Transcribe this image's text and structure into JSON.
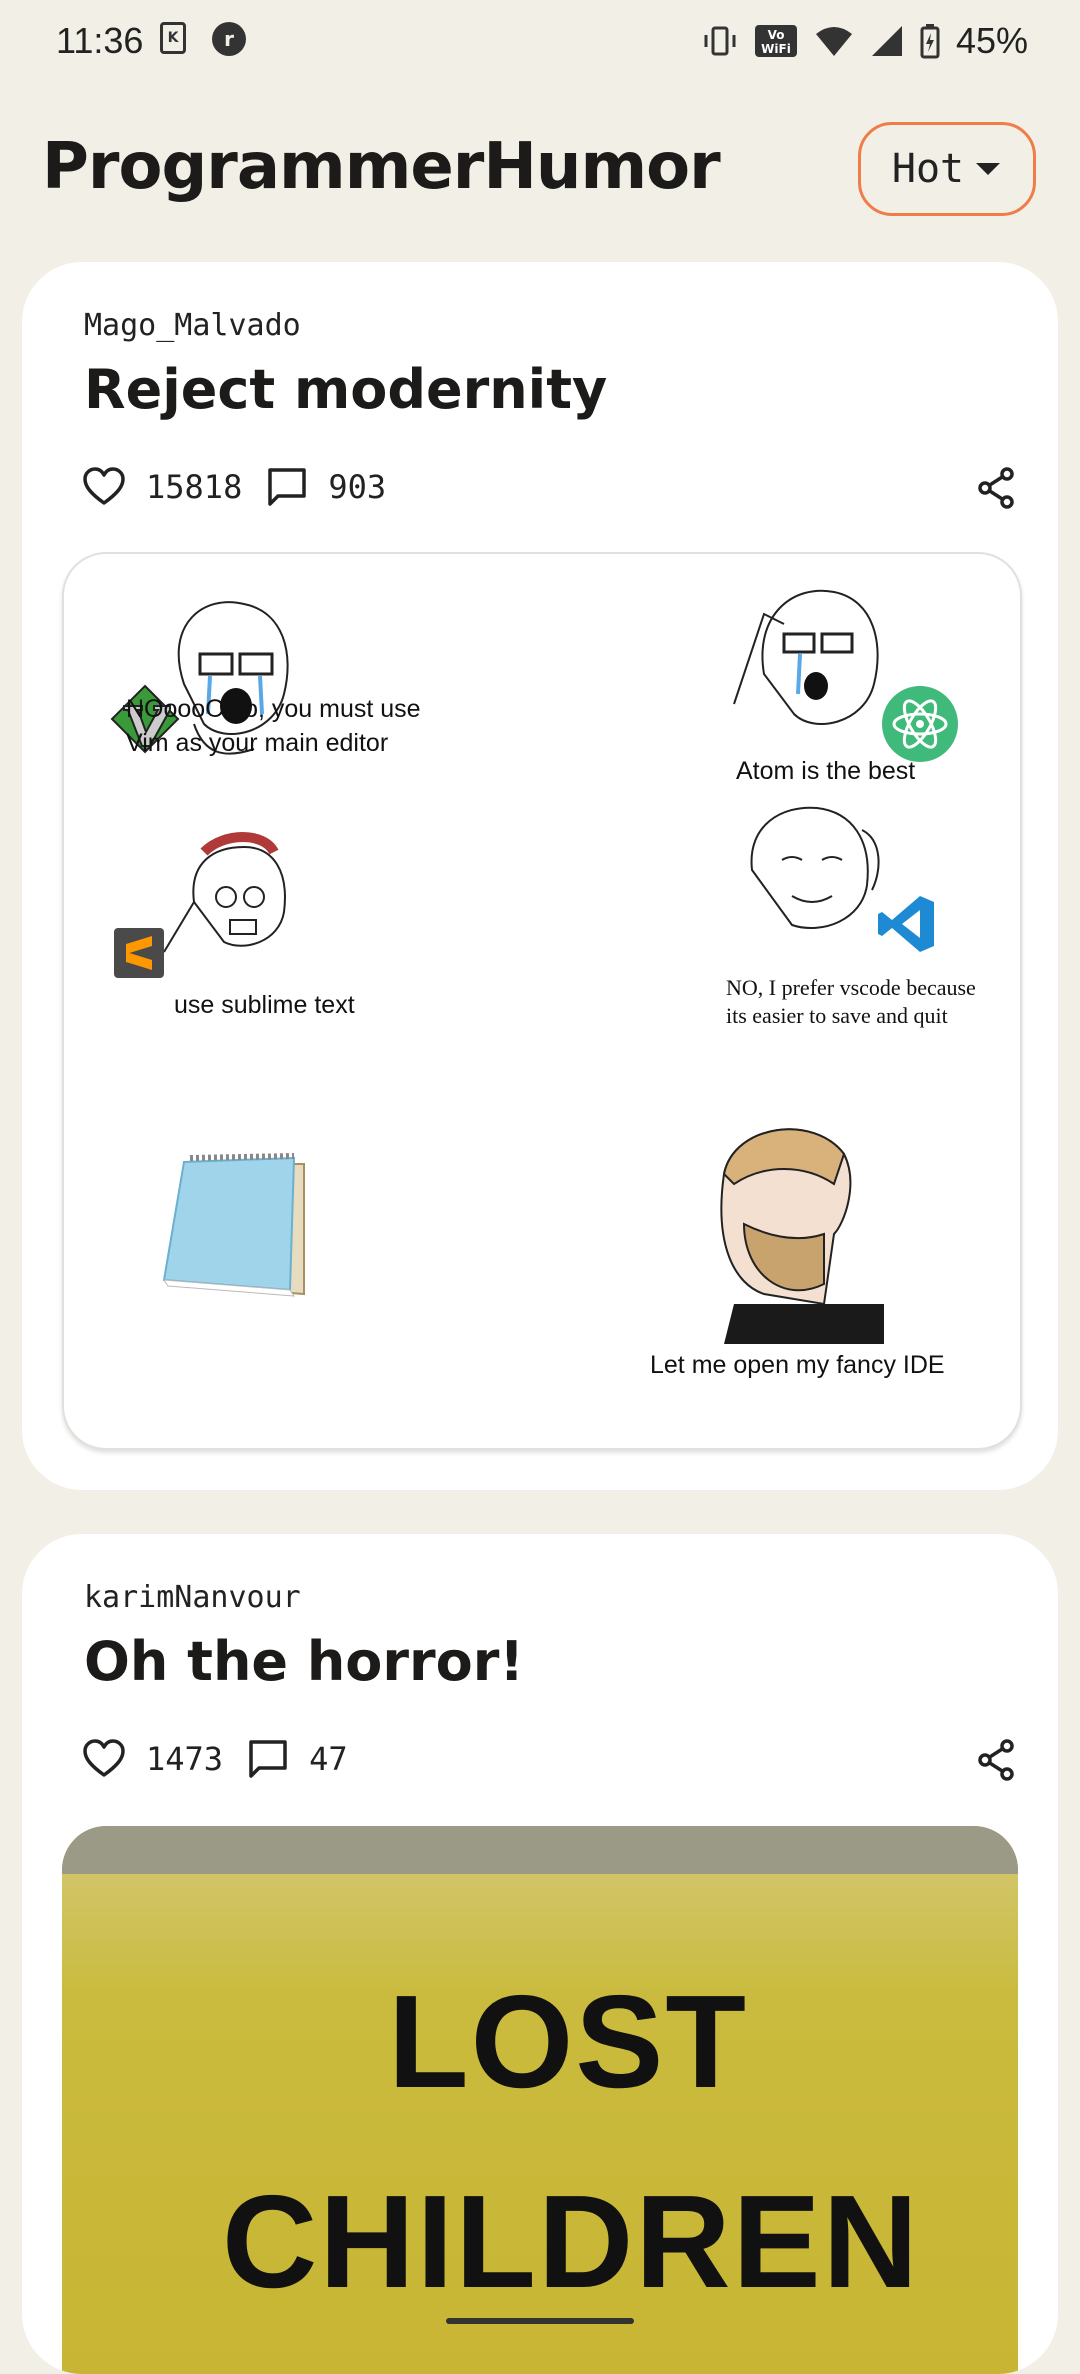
{
  "status_bar": {
    "time": "11:36",
    "battery": "45%"
  },
  "header": {
    "subreddit": "ProgrammerHumor",
    "sort_label": "Hot"
  },
  "posts": [
    {
      "author": "Mago_Malvado",
      "title": "Reject modernity",
      "likes": "15818",
      "comments": "903",
      "meme_captions": {
        "vim": "NOoooOOo, you must use\nVim as your main editor",
        "atom": "Atom is the best",
        "sublime": "use sublime text",
        "vscode": "NO, I prefer vscode because\nits easier to save and quit",
        "ide": "Let me open my fancy IDE",
        "vim_logo": "Vim"
      }
    },
    {
      "author": "karimNanvour",
      "title": "Oh the horror!",
      "likes": "1473",
      "comments": "47",
      "sign_lines": [
        "LOST",
        "CHILDREN"
      ]
    }
  ],
  "colors": {
    "accent": "#ef7d4a",
    "background": "#f2efe6",
    "card": "#ffffff"
  }
}
